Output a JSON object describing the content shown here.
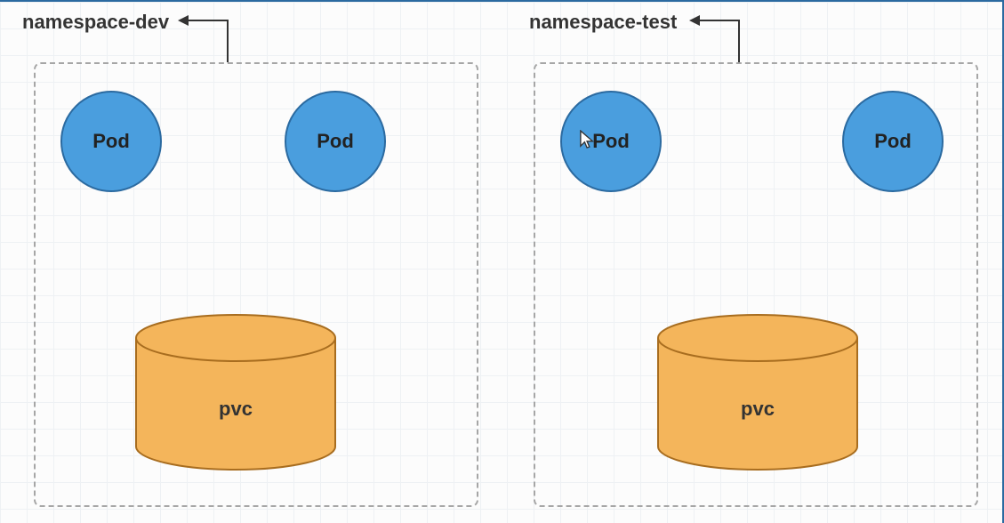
{
  "namespaces": [
    {
      "label": "namespace-dev",
      "pods": [
        "Pod",
        "Pod"
      ],
      "pvc_label": "pvc",
      "show_cursor": false
    },
    {
      "label": "namespace-test",
      "pods": [
        "Pod",
        "Pod"
      ],
      "pvc_label": "pvc",
      "show_cursor": true
    }
  ],
  "colors": {
    "pod_fill": "#4a9ede",
    "pod_stroke": "#2b6aa0",
    "pvc_fill": "#f4b55b",
    "pvc_stroke": "#a86d1f",
    "border_dark": "#333333"
  }
}
